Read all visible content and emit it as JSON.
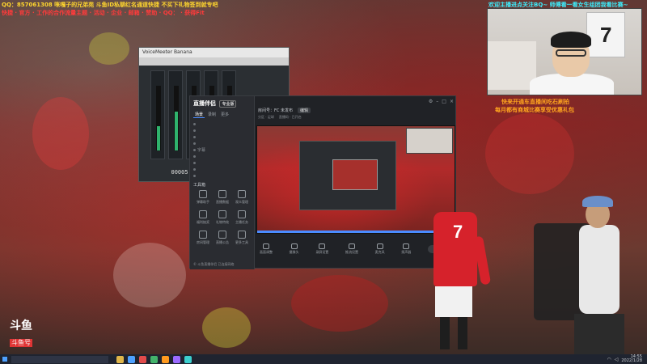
{
  "overlay": {
    "top_left_line1": "QQ：857061308 咪嘎子的兄弟苑 斗鱼ID私聊红名通道快捷 不买下礼物签到就专吧",
    "top_left_line2": "快捷 · 官方 · 工作的合作流量主题 · 活动 · 企业 · 邮箱 · 赞助 · QQ：  · 获得Fit",
    "top_right_line1": "欢迎主播进点关注BQ~    师傅看一看女生组团我看比赛~",
    "right_line1": "快来开通车直播间吃石刷拍",
    "right_line2": "每月都有商城比赛享受优惠礼包"
  },
  "mixer": {
    "title": "VoiceMeeter Banana",
    "counter": "00005.03.01.20"
  },
  "app": {
    "logo": "直播伴侣",
    "logo_badge": "专业版",
    "side_tabs": [
      "场景",
      "录制",
      "更多"
    ],
    "scenes": [
      "",
      "",
      "",
      "",
      "字幕",
      "",
      "",
      "",
      "",
      ""
    ],
    "tools_label": "工具箱",
    "tools": [
      {
        "label": "弹幕助手",
        "icon": "danmaku-icon"
      },
      {
        "label": "直播数据",
        "icon": "data-icon"
      },
      {
        "label": "观众管理",
        "icon": "audience-icon"
      },
      {
        "label": "福利抽奖",
        "icon": "lottery-icon"
      },
      {
        "label": "礼物特效",
        "icon": "gift-icon"
      },
      {
        "label": "主播任务",
        "icon": "task-icon"
      },
      {
        "label": "房间管理",
        "icon": "room-icon"
      },
      {
        "label": "直播公告",
        "icon": "notice-icon"
      },
      {
        "label": "更多工具",
        "icon": "more-icon"
      }
    ],
    "footer": "© 斗鱼直播伴侣 已连接网络",
    "info": {
      "room": "房间号：FC 未发布",
      "btn": "编辑",
      "sub1": "分区 · 足球",
      "sub2": "直播码 · 已开启"
    },
    "controls": [
      {
        "label": "画面调整",
        "icon": "screen-icon"
      },
      {
        "label": "摄像头",
        "icon": "camera-icon"
      },
      {
        "label": "录屏设置",
        "icon": "record-icon"
      },
      {
        "label": "推流设置",
        "icon": "stream-icon"
      },
      {
        "label": "麦克风",
        "icon": "mic-icon"
      },
      {
        "label": "扬声器",
        "icon": "speaker-icon"
      }
    ],
    "start_btn": "开始直播"
  },
  "webcam": {
    "jersey_number": "7"
  },
  "player": {
    "number": "7"
  },
  "watermark": {
    "top": "斗鱼",
    "bottom": "斗鱼号"
  },
  "taskbar": {
    "search_placeholder": "",
    "time": "14:55",
    "date": "2022/1/28"
  },
  "colors": {
    "accent": "#4a8cff",
    "overlay_red": "#ff3b3b",
    "overlay_yellow": "#ffd62e",
    "overlay_cyan": "#3cf0ff",
    "overlay_orange": "#ffa51f"
  }
}
